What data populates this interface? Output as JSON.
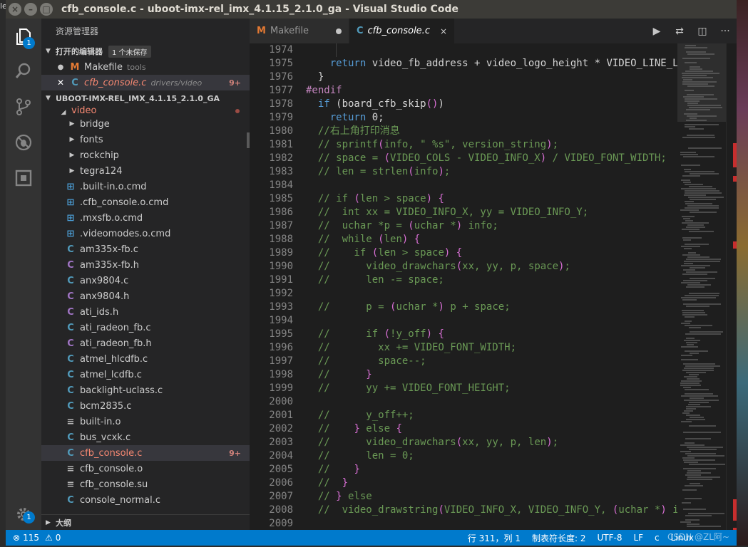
{
  "desktop": {
    "glyph": "le"
  },
  "window": {
    "title": "cfb_console.c - uboot-imx-rel_imx_4.1.15_2.1.0_ga - Visual Studio Code"
  },
  "activity_bar": {
    "explorer_badge": "1",
    "settings_badge": "1"
  },
  "sidebar": {
    "title": "资源管理器",
    "open_editors": {
      "label": "打开的编辑器",
      "unsaved_badge": "1 个未保存",
      "items": [
        {
          "name": "Makefile",
          "desc": "tools",
          "icon": "M"
        },
        {
          "name": "cfb_console.c",
          "desc": "drivers/video",
          "count": "9+",
          "icon": "C"
        }
      ]
    },
    "project": {
      "label": "UBOOT-IMX-REL_IMX_4.1.15_2.1.0_GA",
      "folder": "video",
      "items": [
        {
          "name": "bridge",
          "icon": "folder"
        },
        {
          "name": "fonts",
          "icon": "folder"
        },
        {
          "name": "rockchip",
          "icon": "folder"
        },
        {
          "name": "tegra124",
          "icon": "folder"
        },
        {
          "name": ".built-in.o.cmd",
          "icon": "win"
        },
        {
          "name": ".cfb_console.o.cmd",
          "icon": "win"
        },
        {
          "name": ".mxsfb.o.cmd",
          "icon": "win"
        },
        {
          "name": ".videomodes.o.cmd",
          "icon": "win"
        },
        {
          "name": "am335x-fb.c",
          "icon": "C"
        },
        {
          "name": "am335x-fb.h",
          "icon": "C"
        },
        {
          "name": "anx9804.c",
          "icon": "C"
        },
        {
          "name": "anx9804.h",
          "icon": "C"
        },
        {
          "name": "ati_ids.h",
          "icon": "C"
        },
        {
          "name": "ati_radeon_fb.c",
          "icon": "C"
        },
        {
          "name": "ati_radeon_fb.h",
          "icon": "C"
        },
        {
          "name": "atmel_hlcdfb.c",
          "icon": "C"
        },
        {
          "name": "atmel_lcdfb.c",
          "icon": "C"
        },
        {
          "name": "backlight-uclass.c",
          "icon": "C"
        },
        {
          "name": "bcm2835.c",
          "icon": "C"
        },
        {
          "name": "built-in.o",
          "icon": "txt"
        },
        {
          "name": "bus_vcxk.c",
          "icon": "C"
        },
        {
          "name": "cfb_console.c",
          "icon": "C",
          "count": "9+"
        },
        {
          "name": "cfb_console.o",
          "icon": "txt"
        },
        {
          "name": "cfb_console.su",
          "icon": "txt"
        },
        {
          "name": "console_normal.c",
          "icon": "C"
        }
      ]
    },
    "outline_label": "大纲"
  },
  "tabs": [
    {
      "name": "Makefile",
      "icon": "M"
    },
    {
      "name": "cfb_console.c",
      "icon": "C",
      "close": "×"
    }
  ],
  "code_lines": [
    {
      "n": "1974",
      "t": ""
    },
    {
      "n": "1975",
      "t": "    return video_fb_address + video_logo_height * VIDEO_LINE_LEN"
    },
    {
      "n": "1976",
      "t": "  }"
    },
    {
      "n": "1977",
      "t": "#endif"
    },
    {
      "n": "1978",
      "t": "  if (board_cfb_skip())"
    },
    {
      "n": "1979",
      "t": "    return 0;"
    },
    {
      "n": "1980",
      "t": "  //右上角打印消息"
    },
    {
      "n": "1981",
      "t": "  // sprintf(info, \" %s\", version_string);"
    },
    {
      "n": "1982",
      "t": "  // space = (VIDEO_COLS - VIDEO_INFO_X) / VIDEO_FONT_WIDTH;"
    },
    {
      "n": "1983",
      "t": "  // len = strlen(info);"
    },
    {
      "n": "1984",
      "t": ""
    },
    {
      "n": "1985",
      "t": "  // if (len > space) {"
    },
    {
      "n": "1986",
      "t": "  //  int xx = VIDEO_INFO_X, yy = VIDEO_INFO_Y;"
    },
    {
      "n": "1987",
      "t": "  //  uchar *p = (uchar *) info;"
    },
    {
      "n": "1988",
      "t": "  //  while (len) {"
    },
    {
      "n": "1989",
      "t": "  //    if (len > space) {"
    },
    {
      "n": "1990",
      "t": "  //      video_drawchars(xx, yy, p, space);"
    },
    {
      "n": "1991",
      "t": "  //      len -= space;"
    },
    {
      "n": "1992",
      "t": ""
    },
    {
      "n": "1993",
      "t": "  //      p = (uchar *) p + space;"
    },
    {
      "n": "1994",
      "t": ""
    },
    {
      "n": "1995",
      "t": "  //      if (!y_off) {"
    },
    {
      "n": "1996",
      "t": "  //        xx += VIDEO_FONT_WIDTH;"
    },
    {
      "n": "1997",
      "t": "  //        space--;"
    },
    {
      "n": "1998",
      "t": "  //      }"
    },
    {
      "n": "1999",
      "t": "  //      yy += VIDEO_FONT_HEIGHT;"
    },
    {
      "n": "2000",
      "t": ""
    },
    {
      "n": "2001",
      "t": "  //      y_off++;"
    },
    {
      "n": "2002",
      "t": "  //    } else {"
    },
    {
      "n": "2003",
      "t": "  //      video_drawchars(xx, yy, p, len);"
    },
    {
      "n": "2004",
      "t": "  //      len = 0;"
    },
    {
      "n": "2005",
      "t": "  //    }"
    },
    {
      "n": "2006",
      "t": "  //  }"
    },
    {
      "n": "2007",
      "t": "  // } else"
    },
    {
      "n": "2008",
      "t": "  //  video_drawstring(VIDEO_INFO_X, VIDEO_INFO_Y, (uchar *) in"
    },
    {
      "n": "2009",
      "t": ""
    }
  ],
  "status": {
    "errors": "115",
    "warnings": "0",
    "cursor": "行 311，列 1",
    "tab_size": "制表符长度: 2",
    "encoding": "UTF-8",
    "eol": "LF",
    "language": "c",
    "os": "Linux",
    "watermark": "CSDN @ZL阿~"
  },
  "colors": {
    "accent": "#007acc",
    "error": "#f48771",
    "comment": "#6a9955",
    "keyword": "#569cd6"
  }
}
